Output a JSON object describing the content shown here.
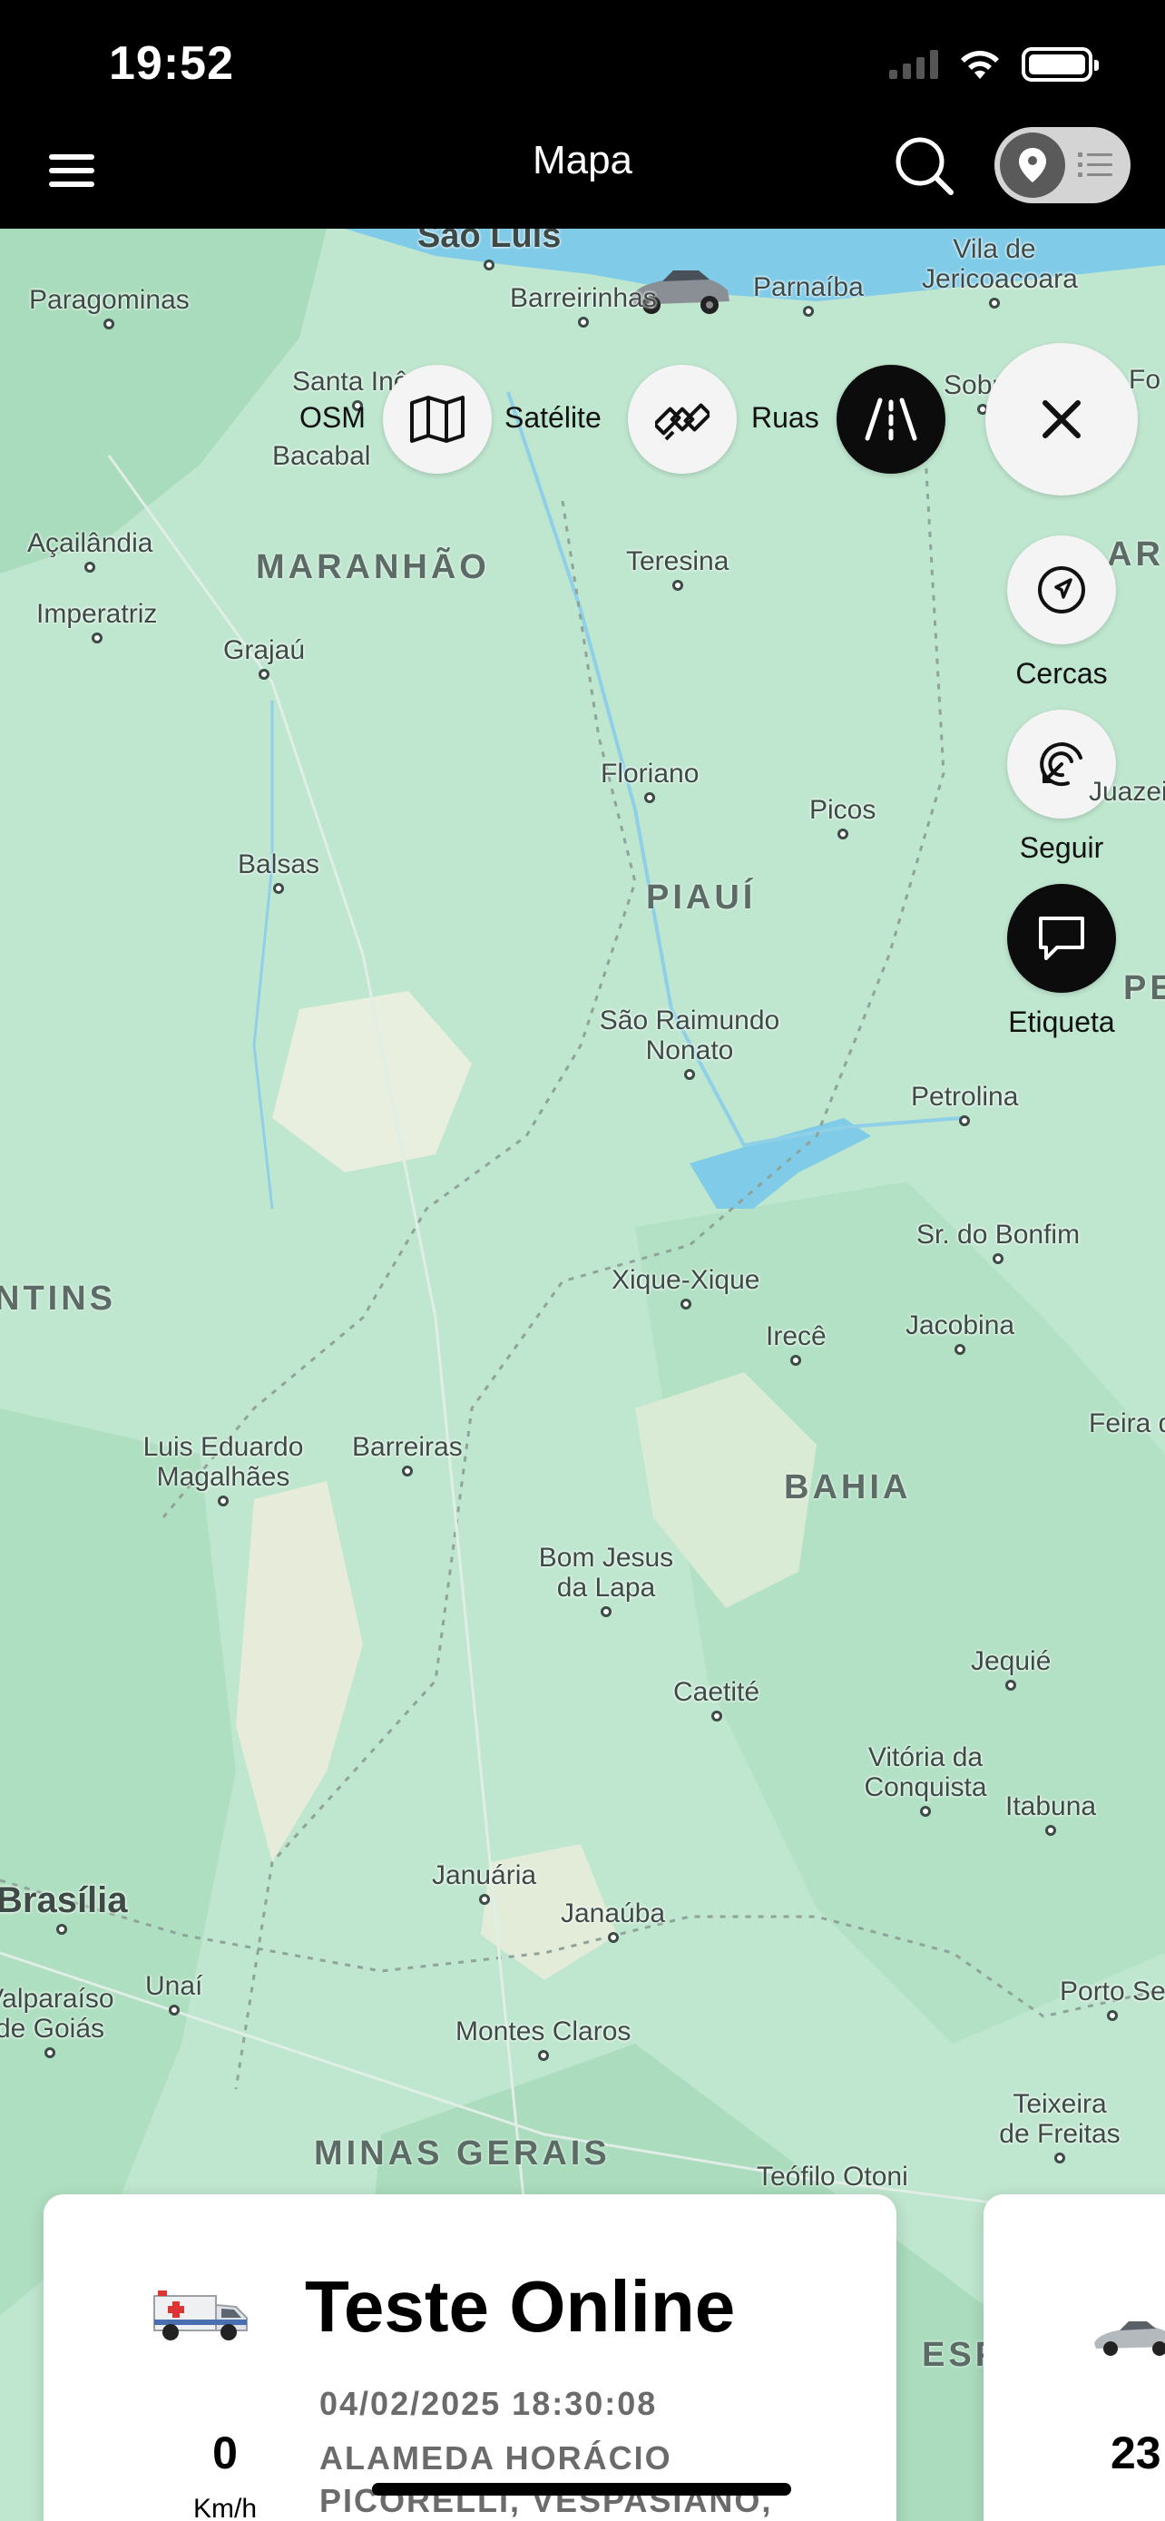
{
  "status_bar": {
    "time": "19:52"
  },
  "header": {
    "title": "Mapa"
  },
  "layers": {
    "osm": "OSM",
    "satellite": "Satélite",
    "streets": "Ruas"
  },
  "side_actions": {
    "fences": "Cercas",
    "follow": "Seguir",
    "label": "Etiqueta"
  },
  "map": {
    "places": [
      "São Luís",
      "Barreirinhas",
      "Parnaíba",
      "Vila de Jericoacoara",
      "Paragominas",
      "Santa Inês",
      "Bacabal",
      "Sobral",
      "Açailândia",
      "Imperatriz",
      "Grajaú",
      "Teresina",
      "Floriano",
      "Picos",
      "Balsas",
      "São Raimundo Nonato",
      "Petrolina",
      "Sr. do Bonfim",
      "Xique-Xique",
      "Irecê",
      "Jacobina",
      "Luis Eduardo Magalhães",
      "Barreiras",
      "Bom Jesus da Lapa",
      "Jequié",
      "Caetité",
      "Vitória da Conquista",
      "Itabuna",
      "Brasília",
      "Januária",
      "Janaúba",
      "Unaí",
      "Valparaíso de Goiás",
      "Montes Claros",
      "Porto Se",
      "Teixeira de Freitas",
      "Teófilo Otoni",
      "Feira de Sant",
      "Juazeiro do Norte",
      "Fo"
    ],
    "regions": [
      "MARANHÃO",
      "PIAUÍ",
      "BAHIA",
      "MINAS GERAIS",
      "NTINS",
      "ARÁ",
      "PE",
      "ESP"
    ]
  },
  "vehicle_card": {
    "name": "Teste Online",
    "datetime": "04/02/2025 18:30:08",
    "address": "ALAMEDA HORÁCIO PICORELLI, VESPASIANO,",
    "speed": "0",
    "speed_unit": "Km/h"
  },
  "vehicle_card_2": {
    "speed": "23"
  },
  "colors": {
    "map_land": "#bfe6cf",
    "water": "#7fcbe8",
    "header_bg": "#000000",
    "fab_active": "#0c0c0c"
  }
}
